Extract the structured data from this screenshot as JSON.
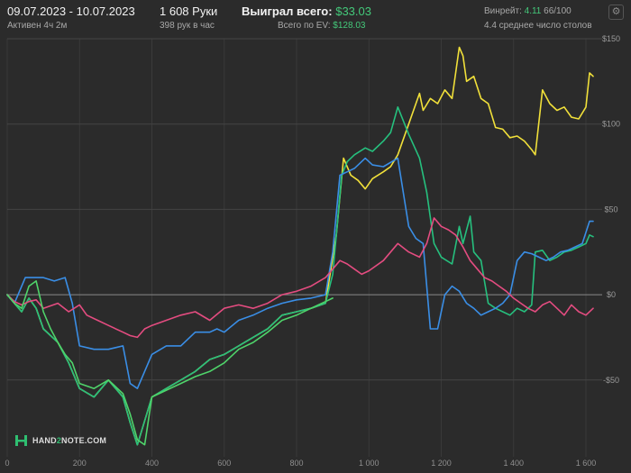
{
  "header": {
    "date_range": "09.07.2023 - 10.07.2023",
    "active_time": "Активен 4ч 2м",
    "hands": "1 608 Руки",
    "hands_per_hour": "398 рук в час",
    "won_label": "Выиграл всего:",
    "won_value": "$33.03",
    "ev_label": "Всего по EV:",
    "ev_value": "$128.03",
    "winrate_label": "Винрейт:",
    "winrate_value": "4.11",
    "winrate_suffix": "66/100",
    "tables": "4.4 среднее число столов"
  },
  "settings": {
    "icon": "gear-icon"
  },
  "logo": {
    "text_left": "HAND",
    "text_mid": "2",
    "text_right": "NOTE.COM"
  },
  "chart_data": {
    "type": "line",
    "xlim": [
      0,
      1620
    ],
    "ylim": [
      -95,
      150
    ],
    "x_ticks": [
      0,
      200,
      400,
      600,
      800,
      1000,
      1200,
      1400,
      1600
    ],
    "x_tick_labels": [
      "0",
      "200",
      "400",
      "600",
      "800",
      "1 000",
      "1 200",
      "1 400",
      "1 600"
    ],
    "y_ticks": [
      150,
      100,
      50,
      0,
      -50
    ],
    "y_tick_labels": [
      "$150",
      "$100",
      "$50",
      "$0",
      "-$50"
    ],
    "grid": true,
    "colors": {
      "yellow": "#f1e03a",
      "green": "#26c07e",
      "blue": "#3a8ee6",
      "pink": "#e44c80",
      "green_light": "#4fd46a"
    },
    "series": [
      {
        "color": "#f1e03a",
        "x": [
          0,
          20,
          40,
          60,
          80,
          100,
          140,
          170,
          200,
          240,
          280,
          320,
          340,
          360,
          400,
          440,
          480,
          520,
          560,
          600,
          640,
          680,
          720,
          760,
          800,
          840,
          880,
          910,
          930,
          950,
          970,
          990,
          1010,
          1040,
          1060,
          1080,
          1110,
          1140,
          1150,
          1170,
          1190,
          1210,
          1230,
          1250,
          1260,
          1270,
          1290,
          1310,
          1330,
          1350,
          1370,
          1390,
          1410,
          1430,
          1450,
          1460,
          1480,
          1500,
          1520,
          1540,
          1560,
          1580,
          1600,
          1610,
          1620
        ],
        "y": [
          0,
          -5,
          -10,
          -2,
          -8,
          -20,
          -28,
          -40,
          -55,
          -60,
          -50,
          -60,
          -75,
          -88,
          -60,
          -55,
          -50,
          -45,
          -38,
          -35,
          -30,
          -25,
          -20,
          -12,
          -10,
          -8,
          -5,
          35,
          80,
          70,
          67,
          62,
          68,
          72,
          75,
          82,
          100,
          118,
          108,
          115,
          112,
          120,
          115,
          145,
          140,
          125,
          128,
          115,
          112,
          98,
          97,
          92,
          93,
          90,
          85,
          82,
          120,
          112,
          108,
          110,
          104,
          103,
          110,
          130,
          128
        ]
      },
      {
        "color": "#26c07e",
        "x": [
          0,
          20,
          40,
          60,
          80,
          100,
          140,
          170,
          200,
          240,
          280,
          320,
          340,
          360,
          400,
          440,
          480,
          520,
          560,
          600,
          640,
          680,
          720,
          760,
          800,
          840,
          880,
          900,
          910,
          925,
          940,
          960,
          990,
          1010,
          1040,
          1060,
          1080,
          1110,
          1140,
          1160,
          1180,
          1200,
          1230,
          1250,
          1260,
          1280,
          1290,
          1310,
          1330,
          1350,
          1370,
          1390,
          1410,
          1430,
          1450,
          1460,
          1480,
          1500,
          1520,
          1540,
          1560,
          1580,
          1600,
          1610,
          1620
        ],
        "y": [
          0,
          -5,
          -10,
          -2,
          -8,
          -20,
          -28,
          -40,
          -55,
          -60,
          -50,
          -60,
          -75,
          -88,
          -60,
          -55,
          -50,
          -45,
          -38,
          -35,
          -30,
          -25,
          -20,
          -12,
          -10,
          -8,
          -5,
          12,
          35,
          70,
          78,
          82,
          86,
          84,
          90,
          95,
          110,
          94,
          80,
          60,
          30,
          22,
          18,
          40,
          30,
          46,
          25,
          20,
          -5,
          -8,
          -10,
          -12,
          -8,
          -10,
          -6,
          25,
          26,
          20,
          22,
          25,
          26,
          28,
          30,
          35,
          34
        ]
      },
      {
        "color": "#3a8ee6",
        "x": [
          0,
          20,
          50,
          100,
          130,
          160,
          180,
          200,
          240,
          280,
          320,
          340,
          360,
          400,
          440,
          480,
          520,
          560,
          580,
          600,
          640,
          680,
          720,
          760,
          800,
          840,
          880,
          900,
          920,
          940,
          960,
          990,
          1010,
          1040,
          1080,
          1110,
          1130,
          1150,
          1170,
          1190,
          1210,
          1230,
          1250,
          1270,
          1290,
          1310,
          1330,
          1350,
          1370,
          1390,
          1410,
          1430,
          1450,
          1470,
          1490,
          1510,
          1530,
          1550,
          1570,
          1590,
          1610,
          1620
        ],
        "y": [
          0,
          -5,
          10,
          10,
          8,
          10,
          -5,
          -30,
          -32,
          -32,
          -30,
          -52,
          -55,
          -35,
          -30,
          -30,
          -22,
          -22,
          -20,
          -22,
          -15,
          -12,
          -8,
          -5,
          -3,
          -2,
          0,
          25,
          70,
          72,
          74,
          80,
          76,
          75,
          80,
          40,
          33,
          30,
          -20,
          -20,
          0,
          5,
          2,
          -5,
          -8,
          -12,
          -10,
          -8,
          -5,
          0,
          20,
          25,
          24,
          22,
          20,
          22,
          25,
          26,
          28,
          30,
          43,
          43
        ]
      },
      {
        "color": "#e44c80",
        "x": [
          0,
          20,
          40,
          60,
          80,
          100,
          140,
          170,
          200,
          220,
          240,
          280,
          320,
          340,
          360,
          380,
          400,
          440,
          480,
          520,
          560,
          600,
          640,
          680,
          720,
          760,
          800,
          840,
          880,
          900,
          920,
          940,
          960,
          980,
          1000,
          1040,
          1080,
          1110,
          1140,
          1160,
          1180,
          1200,
          1220,
          1240,
          1260,
          1280,
          1300,
          1320,
          1340,
          1360,
          1380,
          1400,
          1420,
          1440,
          1460,
          1480,
          1500,
          1520,
          1540,
          1560,
          1580,
          1600,
          1620
        ],
        "y": [
          0,
          -4,
          -6,
          -4,
          -3,
          -8,
          -5,
          -10,
          -6,
          -12,
          -14,
          -18,
          -22,
          -24,
          -25,
          -20,
          -18,
          -15,
          -12,
          -10,
          -15,
          -8,
          -6,
          -8,
          -5,
          0,
          2,
          5,
          10,
          15,
          20,
          18,
          15,
          12,
          14,
          20,
          30,
          25,
          22,
          30,
          45,
          40,
          38,
          35,
          28,
          20,
          15,
          10,
          8,
          5,
          2,
          -2,
          -5,
          -8,
          -10,
          -6,
          -4,
          -8,
          -12,
          -6,
          -10,
          -12,
          -8
        ]
      },
      {
        "color": "#4fd46a",
        "x": [
          0,
          20,
          40,
          60,
          80,
          100,
          120,
          140,
          160,
          180,
          200,
          240,
          280,
          320,
          340,
          360,
          380,
          400,
          420,
          440,
          480,
          520,
          560,
          600,
          640,
          680,
          720,
          760,
          800,
          840,
          880,
          900
        ],
        "y": [
          0,
          -5,
          -8,
          5,
          8,
          -10,
          -20,
          -28,
          -35,
          -40,
          -52,
          -55,
          -50,
          -58,
          -70,
          -85,
          -88,
          -60,
          -58,
          -56,
          -52,
          -48,
          -45,
          -40,
          -32,
          -28,
          -22,
          -15,
          -12,
          -8,
          -4,
          -2
        ]
      }
    ]
  }
}
